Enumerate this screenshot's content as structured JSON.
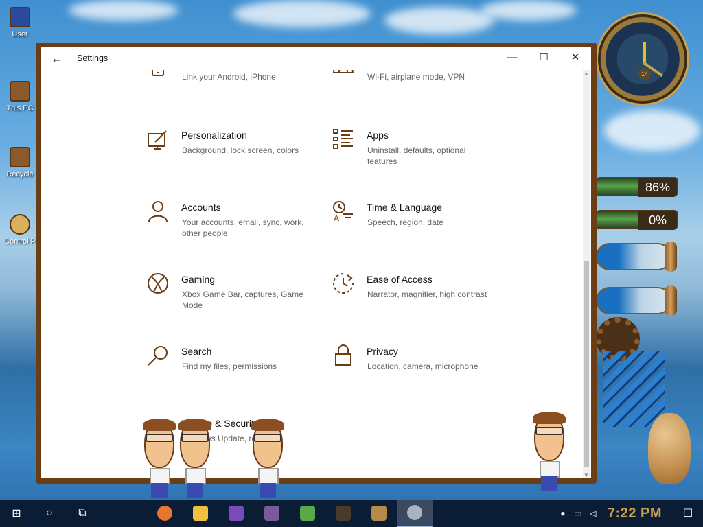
{
  "desktop": {
    "icons": [
      {
        "label": "User"
      },
      {
        "label": "This PC"
      },
      {
        "label": "Recycle"
      },
      {
        "label": "Control P"
      }
    ],
    "clock_widget": {
      "number": "14"
    },
    "gauges": [
      {
        "value": "86%"
      },
      {
        "value": "0%"
      }
    ]
  },
  "window": {
    "title": "Settings",
    "back_glyph": "←",
    "minimize_glyph": "—",
    "maximize_glyph": "☐",
    "close_glyph": "✕",
    "scroll_up": "▲",
    "scroll_down": "▼",
    "tiles": [
      {
        "name": "phone",
        "title": "",
        "desc": "Link your Android, iPhone",
        "icon": "phone-icon"
      },
      {
        "name": "network",
        "title": "",
        "desc": "Wi-Fi, airplane mode, VPN",
        "icon": "globe-icon"
      },
      {
        "name": "personalization",
        "title": "Personalization",
        "desc": "Background, lock screen, colors",
        "icon": "paintbrush-monitor-icon"
      },
      {
        "name": "apps",
        "title": "Apps",
        "desc": "Uninstall, defaults, optional features",
        "icon": "apps-list-icon"
      },
      {
        "name": "accounts",
        "title": "Accounts",
        "desc": "Your accounts, email, sync, work, other people",
        "icon": "person-icon"
      },
      {
        "name": "time-language",
        "title": "Time & Language",
        "desc": "Speech, region, date",
        "icon": "time-language-icon"
      },
      {
        "name": "gaming",
        "title": "Gaming",
        "desc": "Xbox Game Bar, captures, Game Mode",
        "icon": "xbox-icon"
      },
      {
        "name": "ease-of-access",
        "title": "Ease of Access",
        "desc": "Narrator, magnifier, high contrast",
        "icon": "ease-of-access-icon"
      },
      {
        "name": "search",
        "title": "Search",
        "desc": "Find my files, permissions",
        "icon": "magnifier-icon"
      },
      {
        "name": "privacy",
        "title": "Privacy",
        "desc": "Location, camera, microphone",
        "icon": "lock-icon"
      },
      {
        "name": "update-security",
        "title": "Update & Security",
        "desc": "Windows Update, recovery, backup",
        "icon": "sync-icon"
      }
    ]
  },
  "taskbar": {
    "start_glyph": "⊞",
    "search_glyph": "○",
    "taskview_glyph": "⧉",
    "apps": [
      {
        "name": "firefox",
        "color": "#e8762c"
      },
      {
        "name": "file-explorer",
        "color": "#f0c040"
      },
      {
        "name": "visual-studio",
        "color": "#7a4ab8"
      },
      {
        "name": "cat-app",
        "color": "#7a5a9a"
      },
      {
        "name": "notepad-app",
        "color": "#5aa84a"
      },
      {
        "name": "game-app",
        "color": "#4a3a2a"
      },
      {
        "name": "media-app",
        "color": "#b88a4a"
      },
      {
        "name": "settings",
        "color": "#aab4c0"
      }
    ],
    "time": "7:22 PM",
    "notification_glyph": "☐"
  }
}
